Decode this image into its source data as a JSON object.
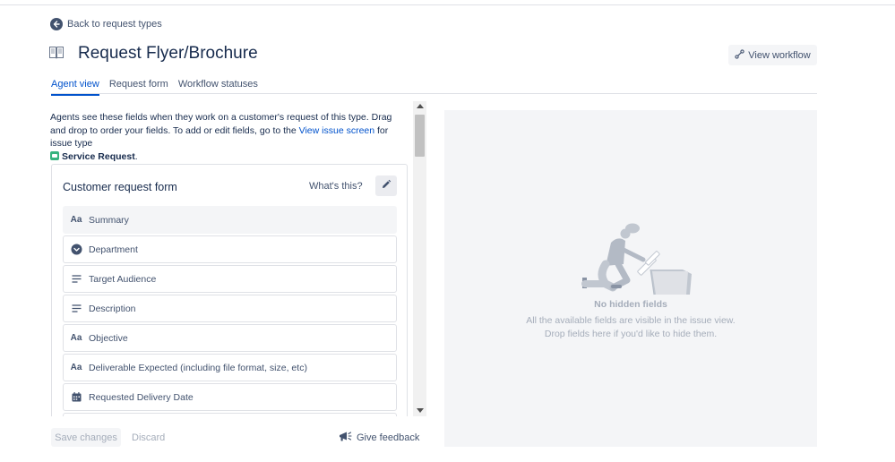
{
  "back_link": {
    "label": "Back to request types"
  },
  "header": {
    "title": "Request Flyer/Brochure",
    "view_workflow_label": "View workflow"
  },
  "tabs": [
    {
      "label": "Agent view",
      "active": true
    },
    {
      "label": "Request form",
      "active": false
    },
    {
      "label": "Workflow statuses",
      "active": false
    }
  ],
  "intro": {
    "text_before_link": "Agents see these fields when they work on a customer's request of this type. Drag and drop to order your fields. To add or edit fields, go to the ",
    "link_label": "View issue screen",
    "text_after_link": " for issue type ",
    "issue_type": "Service Request",
    "end": "."
  },
  "form_card": {
    "title": "Customer request form",
    "whats_this": "What's this?",
    "fields": [
      {
        "label": "Summary",
        "icon": "text-icon",
        "locked": true
      },
      {
        "label": "Department",
        "icon": "select-icon",
        "locked": false
      },
      {
        "label": "Target Audience",
        "icon": "paragraph-icon",
        "locked": false
      },
      {
        "label": "Description",
        "icon": "paragraph-icon",
        "locked": false
      },
      {
        "label": "Objective",
        "icon": "text-icon",
        "locked": false
      },
      {
        "label": "Deliverable Expected (including file format, size, etc)",
        "icon": "text-icon",
        "locked": false
      },
      {
        "label": "Requested Delivery Date",
        "icon": "calendar-icon",
        "locked": false
      }
    ]
  },
  "footer": {
    "save_label": "Save changes",
    "discard_label": "Discard",
    "feedback_label": "Give feedback"
  },
  "hidden_fields": {
    "title": "No hidden fields",
    "line1": "All the available fields are visible in the issue view.",
    "line2": "Drop fields here if you'd like to hide them."
  },
  "colors": {
    "link": "#0052cc",
    "text": "#172b4d",
    "subtle": "#42526e",
    "muted": "#a5adba",
    "service_request": "#36b37e"
  }
}
